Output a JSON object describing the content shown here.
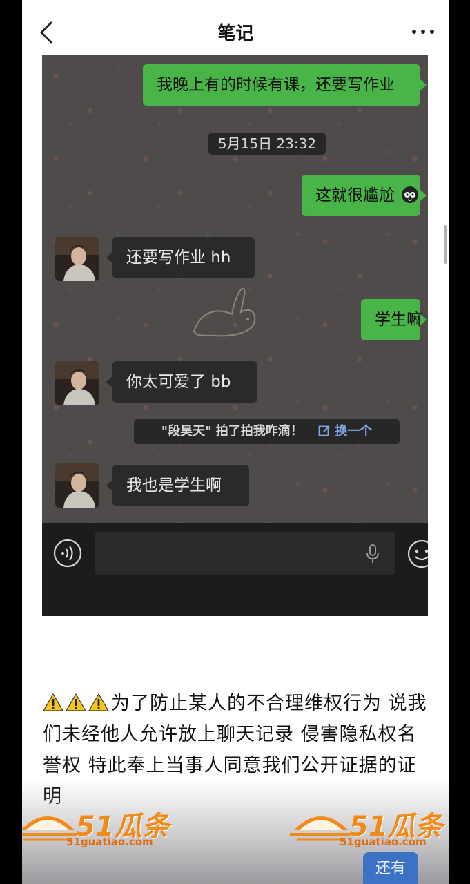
{
  "header": {
    "title": "笔记"
  },
  "chat": {
    "messages": [
      {
        "from": "me",
        "text": "我晚上有的时候有课，还要写作业"
      },
      {
        "from": "system",
        "text": "5月15日 23:32"
      },
      {
        "from": "me",
        "text": "这就很尴尬"
      },
      {
        "from": "them",
        "text": "还要写作业 hh"
      },
      {
        "from": "me",
        "text": "学生嘛"
      },
      {
        "from": "them",
        "text": "你太可爱了 bb"
      },
      {
        "from": "system",
        "text": "\"段昊天\" 拍了拍我咋滴！",
        "action": "换一个"
      },
      {
        "from": "them",
        "text": "我也是学生啊"
      }
    ]
  },
  "note": {
    "text": "为了防止某人的不合理维权行为 说我们未经他人允许放上聊天记录 侵害隐私权名誉权 特此奉上当事人同意我们公开证据的证明"
  },
  "more_button": "还有",
  "watermark": {
    "brand": "51瓜条",
    "site": "51guatiao.com"
  },
  "colors": {
    "my_bubble": "#49b549",
    "their_bubble": "#2a2a2a",
    "watermark": "#f28a1a",
    "more_button": "#3b72c6"
  }
}
